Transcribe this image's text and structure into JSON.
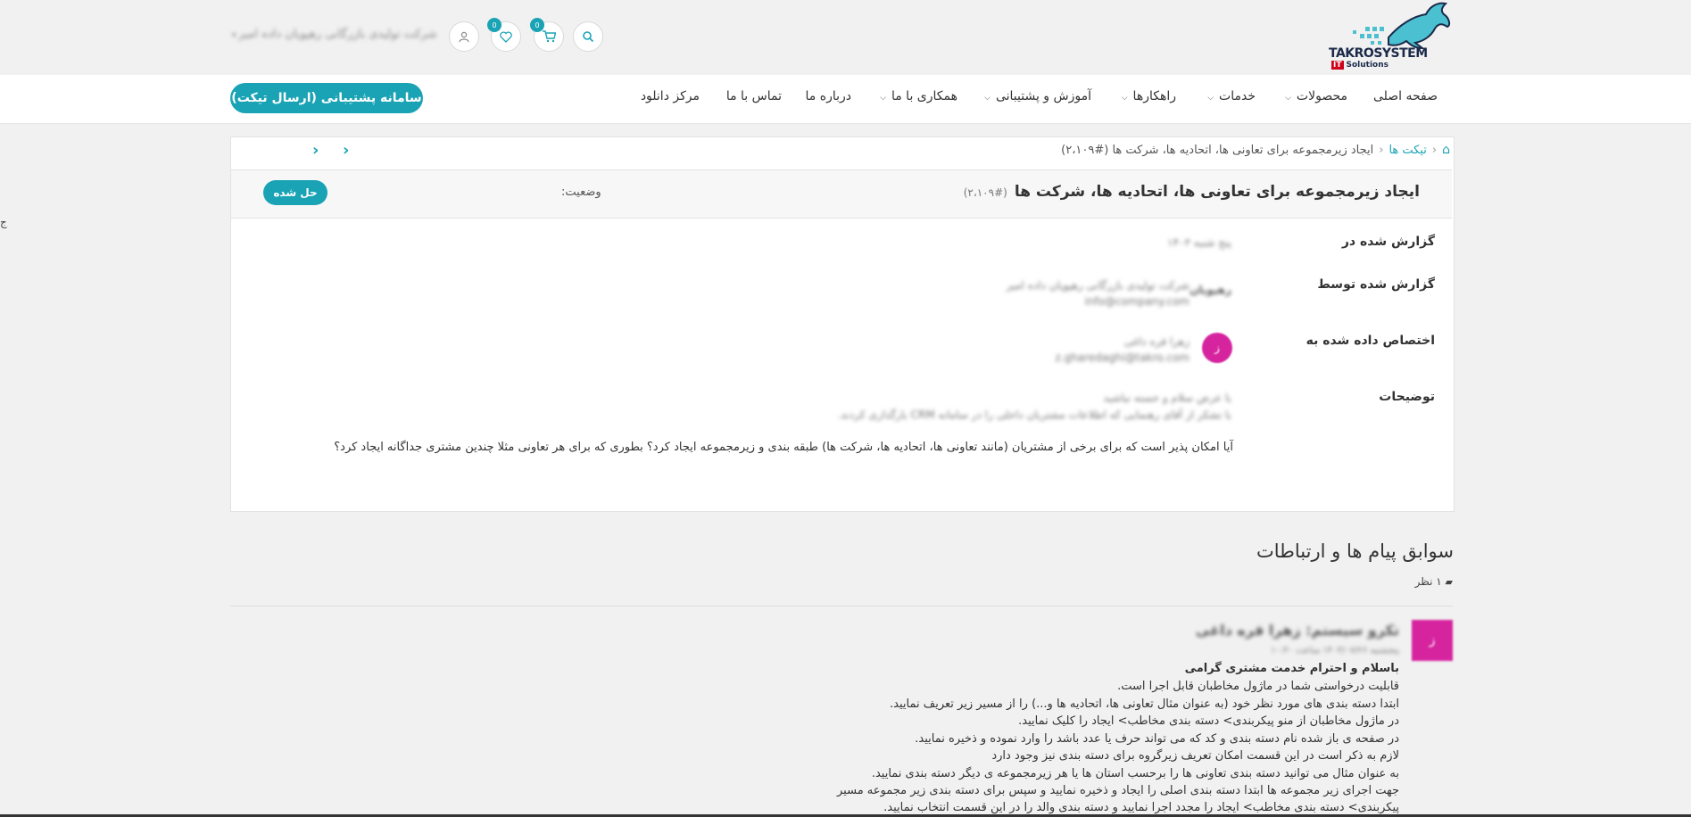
{
  "header": {
    "logo_text": "TAKROSYSTEM",
    "logo_sub_badge": "IT",
    "logo_sub": "Solutions",
    "user_name": "شرکت تولیدی بازرگانی رهپویان داده امیر",
    "cart_count": "0",
    "wishlist_count": "0",
    "icons": [
      "search-icon",
      "cart-icon",
      "heart-icon",
      "user-icon"
    ]
  },
  "nav": {
    "items": [
      {
        "label": "صفحه اصلی",
        "dropdown": false
      },
      {
        "label": "محصولات",
        "dropdown": true
      },
      {
        "label": "خدمات",
        "dropdown": true
      },
      {
        "label": "راهکارها",
        "dropdown": true
      },
      {
        "label": "آموزش و پشتیبانی",
        "dropdown": true
      },
      {
        "label": "همکاری با ما",
        "dropdown": true
      },
      {
        "label": "درباره ما",
        "dropdown": false
      },
      {
        "label": "تماس با ما",
        "dropdown": false
      },
      {
        "label": "مرکز دانلود",
        "dropdown": false
      }
    ],
    "support_button": "سامانه پشتیبانی (ارسال تیکت)"
  },
  "breadcrumb": {
    "home_icon": "home-icon",
    "tickets": "تیکت ها",
    "current": "ایجاد زیرمجموعه برای تعاونی ها، اتحادیه ها، شرکت ها (#۲،۱۰۹)"
  },
  "ticket": {
    "title": "ایجاد زیرمجموعه برای تعاونی ها، اتحادیه ها، شرکت ها",
    "number": "(#۲،۱۰۹)",
    "status_label": "وضعیت:",
    "status_value": "حل شده",
    "fields": {
      "reported_at_label": "گزارش شده در",
      "reported_at_value": "پنج شنبه ۱۴۰۳",
      "reported_by_label": "گزارش شده توسط",
      "reported_by_name": "شرکت تولیدی بازرگانی رهپویان داده امیر",
      "reported_by_email": "info@company.com",
      "reported_by_avatar": "رهپویان",
      "assigned_label": "اختصاص داده شده به",
      "assigned_name": "زهرا قره داغی",
      "assigned_email": "z.gharedaghi@takro.com",
      "assigned_avatar": "ز",
      "desc_label": "توضیحات",
      "desc_line1": "با عرض سلام و خسته نباشید",
      "desc_line2": "با تشکر از آقای رهنمایی که اطلاعات مشتریان داخلی را در سامانه CRM بارگذاری کردند.",
      "question": "آیا امکان پذیر است که برای برخی از مشتریان (مانند تعاونی ها، اتحادیه ها، شرکت ها) طبقه بندی و زیرمجموعه ایجاد کرد؟ بطوری که برای هر تعاونی مثلا چندین مشتری جداگانه ایجاد کرد؟"
    }
  },
  "history": {
    "title": "سوابق پیام ها و ارتباطات",
    "count": "۱ نظر",
    "comment": {
      "avatar": "ز",
      "author": "تکرو سیستم: زهرا قره داغی",
      "meta": "پنجشنبه ۱۴۰۳/۰۷/۲۶ ساعت ۱۰:۳۰",
      "lines": [
        "باسلام و احترام خدمت مشتری گرامی",
        "قابلیت درخواستی شما در ماژول مخاطبان قابل اجرا است.",
        "ابتدا دسته بندی های مورد نظر خود (به عنوان مثال تعاونی ها، اتحادیه ها و...) را از مسیر زیر تعریف نمایید.",
        "در ماژول مخاطبان از منو پیکربندی> دسته بندی مخاطب> ایجاد را کلیک نمایید.",
        "در صفحه ی باز شده نام دسته بندی و کد که می تواند حرف یا عدد باشد را وارد نموده و ذخیره نمایید.",
        "لازم به ذکر است در این قسمت امکان تعریف زیرگروه برای دسته بندی نیز وجود دارد",
        "به عنوان مثال می توانید دسته بندی تعاونی ها را برحسب استان ها یا هر زیرمجموعه ی دیگر دسته بندی نمایید.",
        "جهت اجرای زیر مجموعه ها ابتدا دسته بندی اصلی را ایجاد و ذخیره نمایید و سپس برای دسته بندی زیر مجموعه مسیر",
        "پیکربندی> دسته بندی مخاطب> ایجاد را مجدد اجرا نمایید و دسته بندی والد را در این قسمت انتخاب نمایید."
      ]
    }
  },
  "side_mark": "ج",
  "colors": {
    "accent": "#1aa3b5",
    "avatar": "#d6249f",
    "background": "#f1f1f1"
  }
}
